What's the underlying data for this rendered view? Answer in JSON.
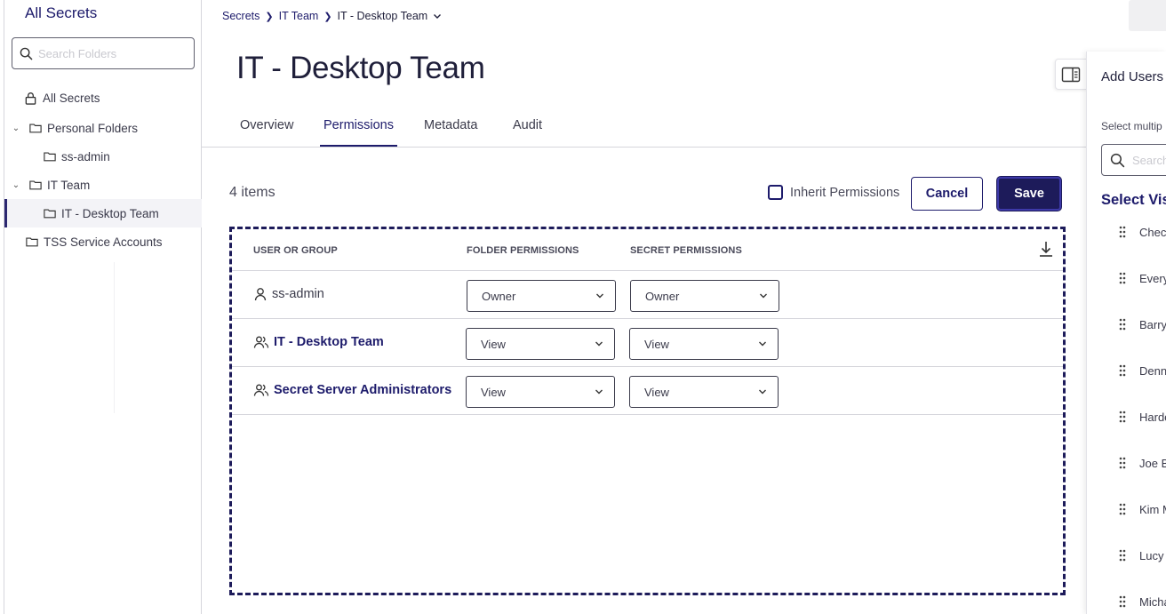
{
  "sidebar": {
    "title": "All Secrets",
    "search_placeholder": "Search Folders",
    "items": [
      {
        "label": "All Secrets",
        "icon": "lock-icon"
      },
      {
        "label": "Personal Folders",
        "icon": "folder-icon",
        "expanded": true
      },
      {
        "label": "ss-admin",
        "icon": "folder-icon"
      },
      {
        "label": "IT Team",
        "icon": "folder-icon",
        "expanded": true
      },
      {
        "label": "IT - Desktop Team",
        "icon": "folder-icon",
        "selected": true
      },
      {
        "label": "TSS Service Accounts",
        "icon": "folder-icon"
      }
    ]
  },
  "breadcrumb": [
    "Secrets",
    "IT Team",
    "IT - Desktop Team"
  ],
  "page_title": "IT - Desktop Team",
  "tabs": [
    {
      "label": "Overview"
    },
    {
      "label": "Permissions",
      "active": true
    },
    {
      "label": "Metadata"
    },
    {
      "label": "Audit"
    }
  ],
  "permissions": {
    "item_count": "4 items",
    "inherit_label": "Inherit Permissions",
    "inherit_checked": false,
    "cancel_label": "Cancel",
    "save_label": "Save",
    "columns": [
      "USER OR GROUP",
      "FOLDER PERMISSIONS",
      "SECRET PERMISSIONS"
    ],
    "rows": [
      {
        "name": "ss-admin",
        "type": "user",
        "folder": "Owner",
        "secret": "Owner"
      },
      {
        "name": "IT - Desktop Team",
        "type": "group",
        "folder": "View",
        "secret": "View"
      },
      {
        "name": "Secret Server Administrators",
        "type": "group",
        "folder": "View",
        "secret": "View"
      }
    ]
  },
  "right_panel": {
    "title": "Add Users a",
    "hint": "Select multip",
    "search_placeholder": "Search",
    "section_title": "Select Vis",
    "items": [
      "Chec",
      "Every",
      "Barry",
      "Denn",
      "Harde",
      "Joe B",
      "Kim M",
      "Lucy",
      "Micha"
    ]
  },
  "colors": {
    "accent": "#1d1b6b",
    "save_bg": "#1d1b5a",
    "border": "#d6d6dc"
  }
}
